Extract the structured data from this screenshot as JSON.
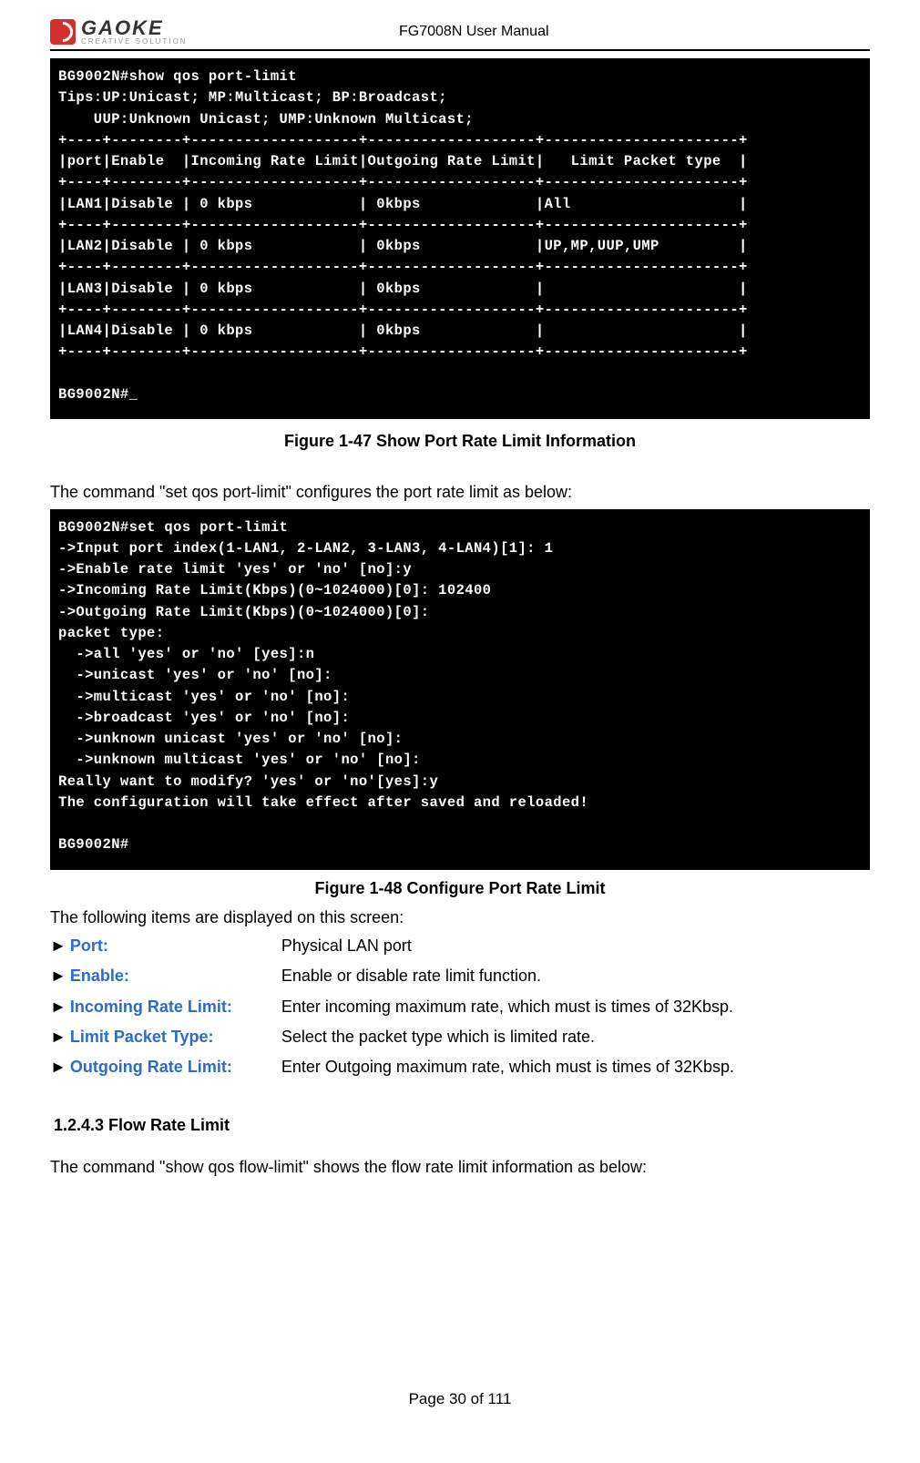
{
  "header": {
    "logo_text": "GAOKE",
    "logo_sub": "CREATIVE SOLUTION",
    "title": "FG7008N User Manual"
  },
  "terminal1": "BG9002N#show qos port-limit\nTips:UP:Unicast; MP:Multicast; BP:Broadcast;\n    UUP:Unknown Unicast; UMP:Unknown Multicast;\n+----+--------+-------------------+-------------------+----------------------+\n|port|Enable  |Incoming Rate Limit|Outgoing Rate Limit|   Limit Packet type  |\n+----+--------+-------------------+-------------------+----------------------+\n|LAN1|Disable | 0 kbps            | 0kbps             |All                   |\n+----+--------+-------------------+-------------------+----------------------+\n|LAN2|Disable | 0 kbps            | 0kbps             |UP,MP,UUP,UMP         |\n+----+--------+-------------------+-------------------+----------------------+\n|LAN3|Disable | 0 kbps            | 0kbps             |                      |\n+----+--------+-------------------+-------------------+----------------------+\n|LAN4|Disable | 0 kbps            | 0kbps             |                      |\n+----+--------+-------------------+-------------------+----------------------+\n\nBG9002N#_",
  "caption1": "Figure 1-47    Show Port Rate Limit Information",
  "intro1": "The command \"set qos port-limit\" configures the port rate limit as below:",
  "terminal2": "BG9002N#set qos port-limit\n->Input port index(1-LAN1, 2-LAN2, 3-LAN3, 4-LAN4)[1]: 1\n->Enable rate limit 'yes' or 'no' [no]:y\n->Incoming Rate Limit(Kbps)(0~1024000)[0]: 102400\n->Outgoing Rate Limit(Kbps)(0~1024000)[0]:\npacket type:\n  ->all 'yes' or 'no' [yes]:n\n  ->unicast 'yes' or 'no' [no]:\n  ->multicast 'yes' or 'no' [no]:\n  ->broadcast 'yes' or 'no' [no]:\n  ->unknown unicast 'yes' or 'no' [no]:\n  ->unknown multicast 'yes' or 'no' [no]:\nReally want to modify? 'yes' or 'no'[yes]:y\nThe configuration will take effect after saved and reloaded!\n\nBG9002N#",
  "caption2": "Figure 1-48    Configure Port Rate Limit",
  "items_intro": "The following items are displayed on this screen:",
  "items": [
    {
      "label": "Port:",
      "desc": "Physical LAN port"
    },
    {
      "label": "Enable:",
      "desc": "Enable or disable rate limit function."
    },
    {
      "label": "Incoming Rate Limit:",
      "desc": "Enter incoming maximum rate, which must is times of 32Kbsp."
    },
    {
      "label": "Limit Packet Type:",
      "desc": "Select the packet type which is limited rate."
    },
    {
      "label": "Outgoing Rate Limit:",
      "desc": "Enter Outgoing maximum rate, which must is times of 32Kbsp."
    }
  ],
  "section_heading": "1.2.4.3    Flow Rate Limit",
  "intro2": "The command \"show qos flow-limit\" shows the flow rate limit information as below:",
  "footer": "Page 30 of 111"
}
